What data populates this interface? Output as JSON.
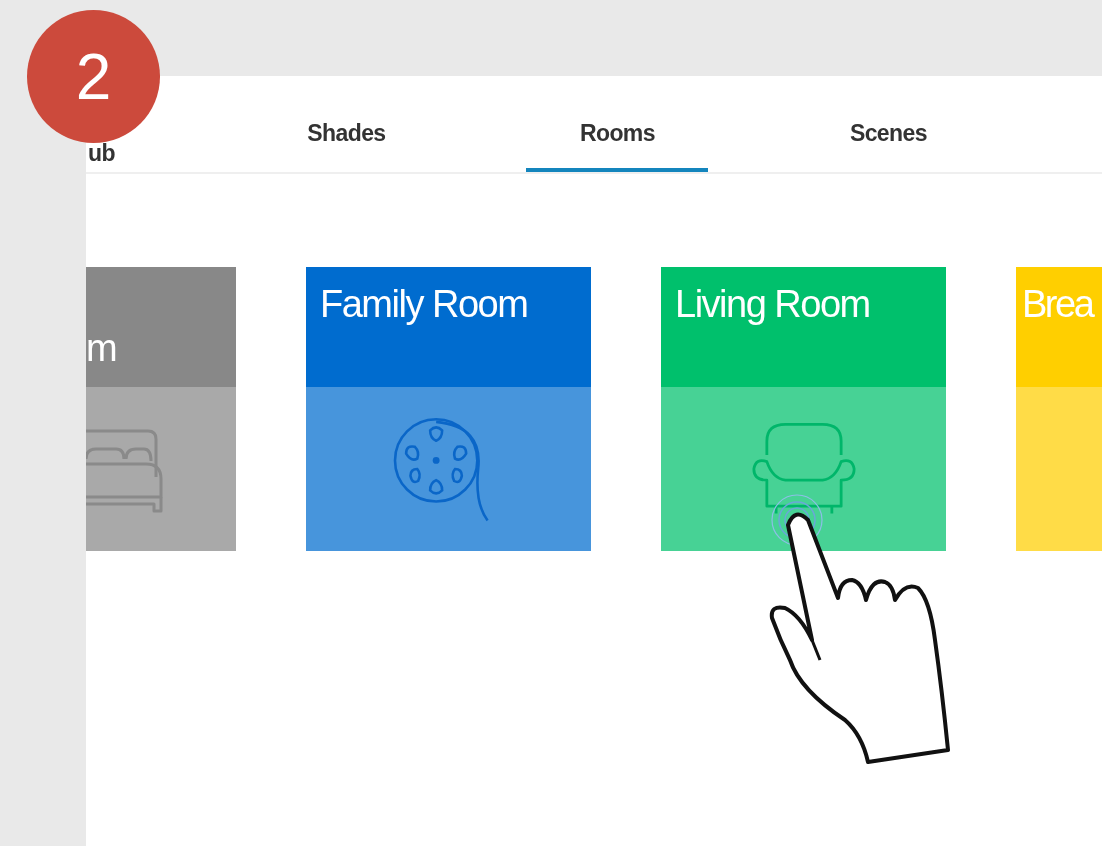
{
  "step_badge": "2",
  "tabs": [
    {
      "label": "ub",
      "selected": false
    },
    {
      "label": "Shades",
      "selected": false
    },
    {
      "label": "Rooms",
      "selected": true
    },
    {
      "label": "Scenes",
      "selected": false
    }
  ],
  "rooms": [
    {
      "title": "m",
      "color": "#888888"
    },
    {
      "title": "Family Room",
      "color": "#006ccf"
    },
    {
      "title": "Living Room",
      "color": "#00c06c"
    },
    {
      "title": "Brea",
      "color": "#ffcf00"
    }
  ]
}
